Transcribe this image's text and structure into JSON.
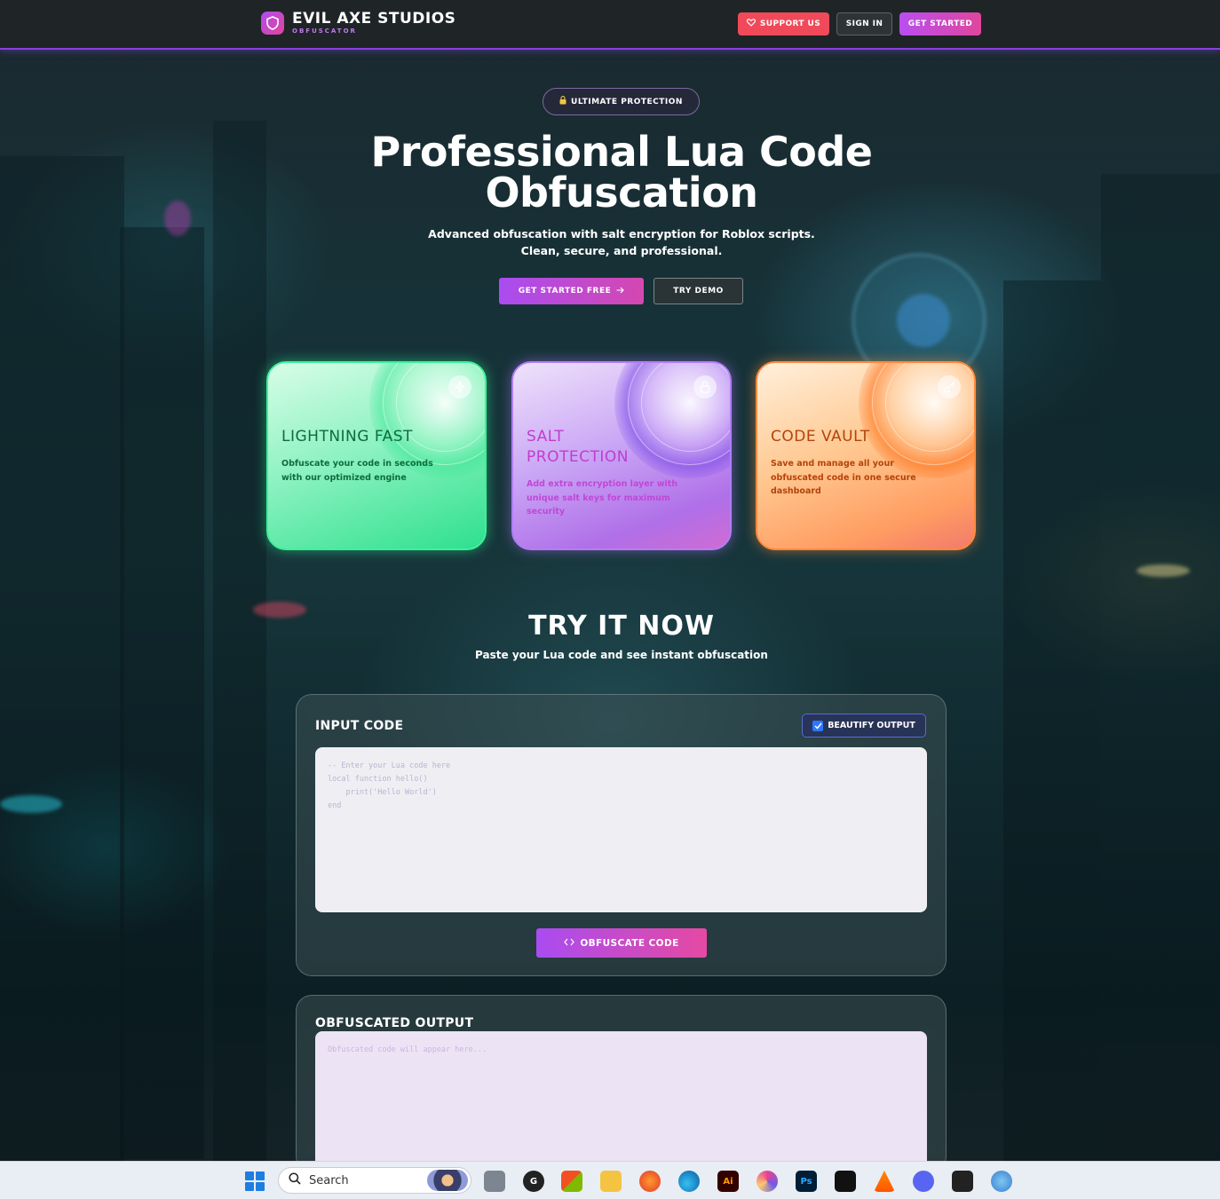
{
  "nav": {
    "brand_title": "EVIL AXE STUDIOS",
    "brand_subtitle": "OBFUSCATOR",
    "support_label": "SUPPORT US",
    "signin_label": "SIGN IN",
    "get_started_label": "GET STARTED"
  },
  "hero": {
    "badge": "ULTIMATE PROTECTION",
    "title_line1": "Professional Lua Code",
    "title_line2": "Obfuscation",
    "subtitle_line1": "Advanced obfuscation with salt encryption for Roblox scripts.",
    "subtitle_line2": "Clean, secure, and professional.",
    "cta_primary": "GET STARTED FREE",
    "cta_secondary": "TRY DEMO"
  },
  "features": [
    {
      "title": "LIGHTNING FAST",
      "desc": "Obfuscate your code in seconds with our optimized engine",
      "icon": "lightning-icon"
    },
    {
      "title": "SALT PROTECTION",
      "desc": "Add extra encryption layer with unique salt keys for maximum security",
      "icon": "lock-icon"
    },
    {
      "title": "CODE VAULT",
      "desc": "Save and manage all your obfuscated code in one secure dashboard",
      "icon": "key-icon"
    }
  ],
  "try_section": {
    "title": "TRY IT NOW",
    "subtitle": "Paste your Lua code and see instant obfuscation"
  },
  "input_panel": {
    "label": "INPUT CODE",
    "beautify_label": "BEAUTIFY OUTPUT",
    "beautify_checked": true,
    "placeholder": "-- Enter your Lua code here\nlocal function hello()\n    print('Hello World')\nend",
    "button_label": "OBFUSCATE CODE"
  },
  "output_panel": {
    "label": "OBFUSCATED OUTPUT",
    "placeholder": "Obfuscated code will appear here..."
  },
  "taskbar": {
    "search_label": "Search"
  },
  "colors": {
    "accent_purple": "#a94cf0",
    "accent_pink": "#e0469d",
    "support_red": "#f04a5a",
    "nav_border": "#8b3fe0"
  }
}
